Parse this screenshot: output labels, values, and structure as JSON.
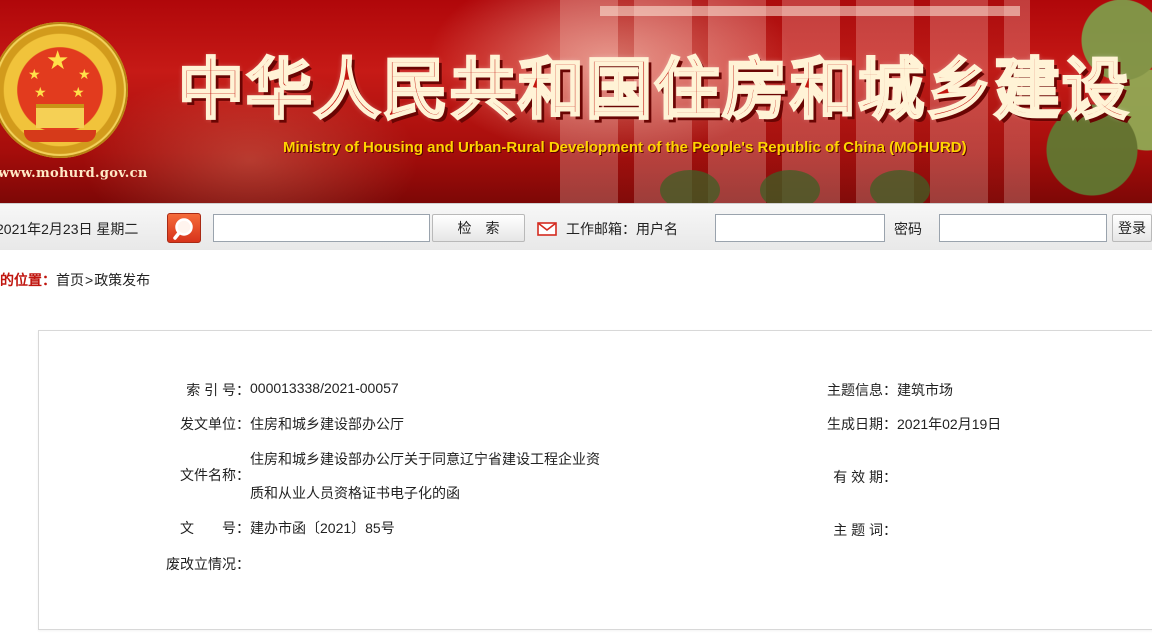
{
  "header": {
    "site_title": "中华人民共和国住房和城乡建设",
    "site_subtitle": "Ministry of Housing and Urban-Rural Development of the People's Republic of China (MOHURD)",
    "site_url": "www.mohurd.gov.cn"
  },
  "toolbar": {
    "date_text": "2021年2月23日 星期二",
    "search_input_value": "",
    "search_button_label": "检　索",
    "mail_label": "工作邮箱：用户名",
    "username_value": "",
    "password_label": "密码",
    "password_value": "",
    "login_button_label": "登录"
  },
  "breadcrumb": {
    "prefix": "您现在的位置：",
    "items": [
      "首页",
      "政策发布"
    ],
    "separator": ">"
  },
  "document_info": {
    "index_label": "索 引 号",
    "index_value": "000013338/2021-00057",
    "issuer_label": "发文单位",
    "issuer_value": "住房和城乡建设部办公厅",
    "title_label": "文件名称",
    "title_line1": "住房和城乡建设部办公厅关于同意辽宁省建设工程企业资",
    "title_line2": "质和从业人员资格证书电子化的函",
    "doc_no_label": "文　　号",
    "doc_no_value": "建办市函〔2021〕85号",
    "status_label": "废改立情况",
    "status_value": "",
    "topic_label": "主题信息",
    "topic_value": "建筑市场",
    "date_label": "生成日期",
    "date_value": "2021年02月19日",
    "validity_label": "有 效 期",
    "validity_value": "",
    "keywords_label": "主 题 词",
    "keywords_value": "",
    "colon": "："
  },
  "colors": {
    "banner_red": "#c3160e",
    "subtitle_yellow": "#ffd400",
    "breadcrumb_red": "#c0150e"
  }
}
